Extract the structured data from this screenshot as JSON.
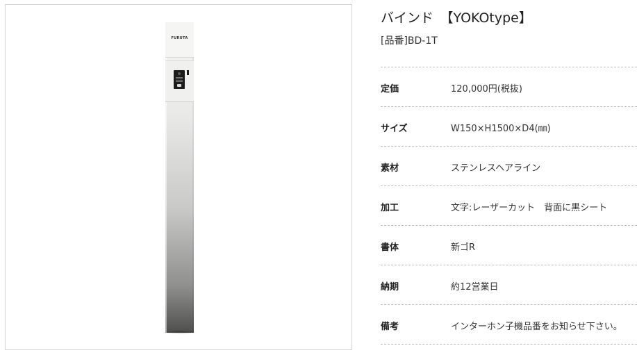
{
  "product": {
    "title": "バインド　【YOKOtype】",
    "code": "[品番]BD-1T",
    "image": {
      "brand_text": "FURUTA"
    }
  },
  "specs": [
    {
      "label": "定価",
      "value": "120,000円(税抜)"
    },
    {
      "label": "サイズ",
      "value": "W150×H1500×D4(㎜)"
    },
    {
      "label": "素材",
      "value": "ステンレスヘアライン"
    },
    {
      "label": "加工",
      "value": "文字:レーザーカット　背面に黒シート"
    },
    {
      "label": "書体",
      "value": "新ゴR"
    },
    {
      "label": "納期",
      "value": "約12営業日"
    },
    {
      "label": "備考",
      "value": "インターホン子機品番をお知らせ下さい。"
    }
  ]
}
